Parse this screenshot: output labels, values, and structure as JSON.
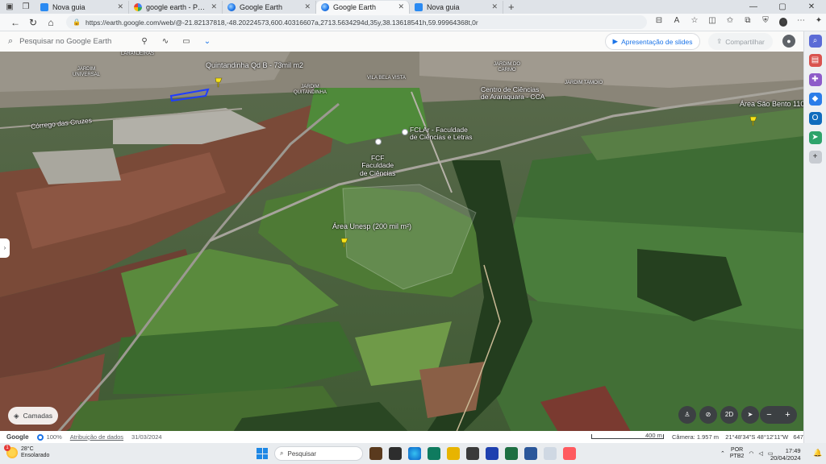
{
  "browser": {
    "tabs": [
      {
        "label": "Nova guia",
        "favicon": "edge-newtab",
        "active": false
      },
      {
        "label": "google earth - Pesquisar",
        "favicon": "search",
        "active": false
      },
      {
        "label": "Google Earth",
        "favicon": "earth",
        "active": false
      },
      {
        "label": "Google Earth",
        "favicon": "earth",
        "active": true
      },
      {
        "label": "Nova guia",
        "favicon": "edge-newtab",
        "active": false
      }
    ],
    "url": "https://earth.google.com/web/@-21.82137818,-48.20224573,600.40316607a,2713.5634294d,35y,38.13618541h,59.99964368t,0r"
  },
  "earth_toolbar": {
    "search_placeholder": "Pesquisar no Google Earth",
    "slides_label": "Apresentação de slides",
    "share_label": "Compartilhar"
  },
  "map_labels": {
    "pin_quintandinha": "Quintandinha Qd B - 73mil m2",
    "pin_unesp": "Área Unesp (200 mil m²)",
    "pin_sao_bento": "Área São Bento 110",
    "corrego": "Córrego das Cruzes",
    "fclar": "FCLAr - Faculdade\nde Ciências e Letras",
    "fcf": "FCF\nFaculdade\nde Ciências",
    "cca": "Centro de Ciências\nde Araraquara - CCA",
    "n_jardim_universal": "JARDIM\nUNIVERSAL",
    "n_jardim_quitandinha": "JARDIM\nQUITANDINHA",
    "n_vila_bela_vista": "VILA BELA VISTA",
    "n_jardim_do_carmo": "JARDIM DO\nCARMO",
    "n_jardim_tamoio": "JARDIM TAMOIO",
    "n_laranjeiras": "LARANJEIRAS"
  },
  "map_controls": {
    "layers_label": "Camadas",
    "view_2d_label": "2D"
  },
  "status_bar": {
    "google": "Google",
    "zoom": "100%",
    "attribution": "Atribuição de dados",
    "date": "31/03/2024",
    "scale": "400 m",
    "camera": "Câmera: 1.957 m",
    "coords": "21°48'34\"S 48°12'11\"W",
    "elevation": "647 m"
  },
  "taskbar": {
    "temperature": "28°C",
    "weather": "Ensolarado",
    "weather_badge": "1",
    "search_label": "Pesquisar",
    "lang_1": "POR",
    "lang_2": "PTB2",
    "time": "17:49",
    "date": "20/04/2024"
  },
  "colors": {
    "accent": "#1a73e8",
    "pin": "#f7e318",
    "polygon": "#1f3dff"
  }
}
